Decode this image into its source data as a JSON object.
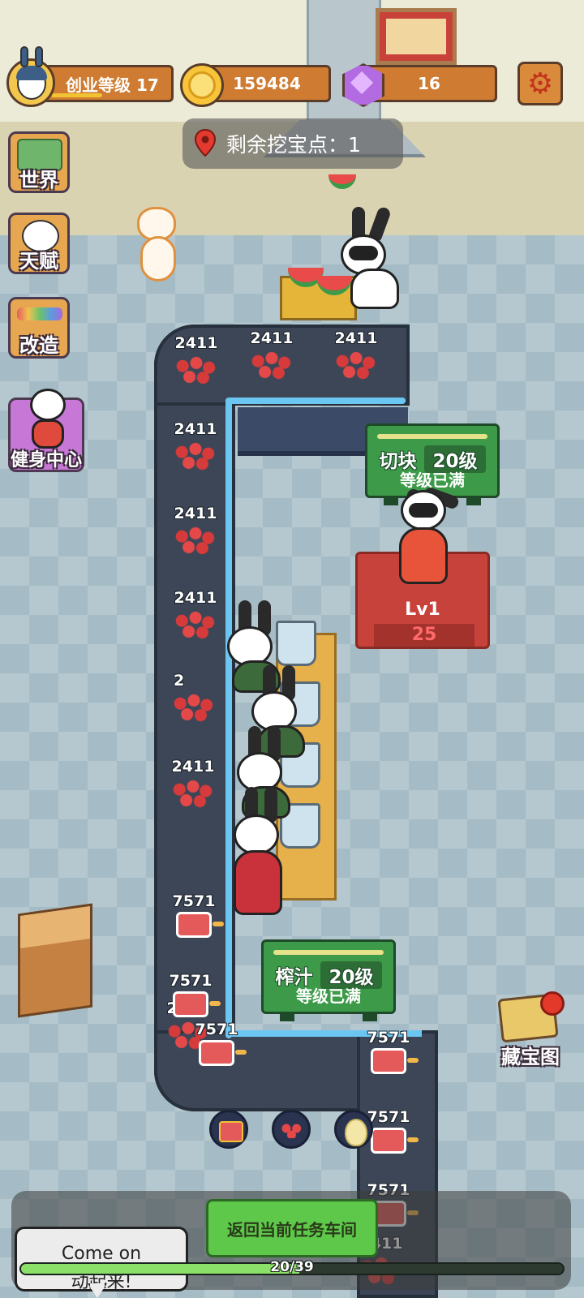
{
  "hud": {
    "level_label": "创业等级 17",
    "level_progress": 0.45,
    "coins": "159484",
    "gems": "16"
  },
  "dig": {
    "label": "剩余挖宝点：1"
  },
  "menu": {
    "world": "世界",
    "talent": "天赋",
    "renovate": "改造",
    "gym": "健身中心"
  },
  "belt": {
    "chunk_counts": [
      "2411",
      "2411",
      "2411",
      "2411",
      "2411",
      "2411",
      "2411",
      "2",
      "2411",
      "2411"
    ],
    "juice_counts": [
      "7571",
      "7571",
      "7571",
      "7571",
      "7571",
      "7571"
    ]
  },
  "stations": {
    "cut": {
      "name": "切块",
      "level": "20级",
      "status": "等级已满"
    },
    "juice": {
      "name": "榨汁",
      "level": "20级",
      "status": "等级已满"
    },
    "pedestal_level": "Lv1",
    "pedestal_value": "25"
  },
  "treasure_map": {
    "label": "藏宝图"
  },
  "bottom": {
    "return_button": "返回当前任务车间",
    "chat_text": "Come on",
    "chat_text_2": "动起来!",
    "progress_text": "20/39",
    "progress_value": 0.5128
  },
  "colors": {
    "hud_orange": "#cf7c32",
    "sign_green": "#3c9a48",
    "belt_dark": "#3c4656",
    "belt_glow": "#6bc6f2",
    "return_green": "#5ec84a"
  },
  "icons": [
    "avatar-icon",
    "coin-icon",
    "gem-icon",
    "gear-icon",
    "location-pin-icon",
    "world-map-icon",
    "talent-icon",
    "paint-roller-icon",
    "gym-icon",
    "treasure-map-icon",
    "juice-cup-icon",
    "melon-chunk-icon",
    "seed-icon"
  ]
}
